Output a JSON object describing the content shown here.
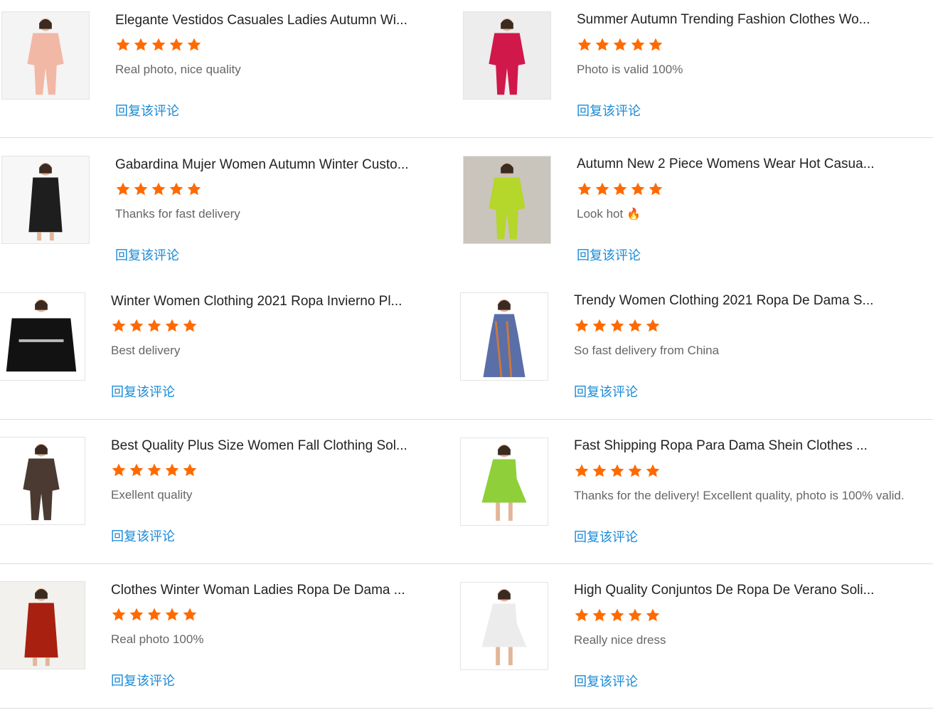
{
  "reviews": [
    {
      "title": "Elegante Vestidos Casuales Ladies Autumn Wi...",
      "comment": "Real photo, nice quality",
      "emoji": "",
      "reply": "回复该评论",
      "image": "pink-blazer-suit",
      "rating": 5
    },
    {
      "title": "Summer Autumn Trending Fashion Clothes Wo...",
      "comment": "Photo is valid 100%",
      "emoji": "",
      "reply": "回复该评论",
      "image": "magenta-suit",
      "rating": 5
    },
    {
      "title": "Gabardina Mujer Women Autumn Winter Custo...",
      "comment": "Thanks for fast delivery",
      "emoji": "",
      "reply": "回复该评论",
      "image": "black-long-coat",
      "rating": 5
    },
    {
      "title": "Autumn New 2 Piece Womens Wear Hot Casua...",
      "comment": "Look hot",
      "emoji": "🔥",
      "reply": "回复该评论",
      "image": "lime-green-suit",
      "rating": 5
    },
    {
      "title": "Winter Women Clothing 2021 Ropa Invierno Pl...",
      "comment": "Best delivery",
      "emoji": "",
      "reply": "回复该评论",
      "image": "black-blazer-chain",
      "rating": 5
    },
    {
      "title": "Trendy Women Clothing 2021 Ropa De Dama S...",
      "comment": "So fast delivery from China",
      "emoji": "",
      "reply": "回复该评论",
      "image": "printed-maxi-dress",
      "rating": 5
    },
    {
      "title": "Best Quality Plus Size Women Fall Clothing Sol...",
      "comment": "Exellent quality",
      "emoji": "",
      "reply": "回复该评论",
      "image": "brown-blazer-outfit",
      "rating": 5
    },
    {
      "title": "Fast Shipping Ropa Para Dama Shein Clothes ...",
      "comment": "Thanks for the delivery! Excellent quality, photo is 100% valid.",
      "emoji": "",
      "reply": "回复该评论",
      "image": "green-print-dress",
      "rating": 5
    },
    {
      "title": "Clothes Winter Woman Ladies Ropa De Dama ...",
      "comment": "Real photo 100%",
      "emoji": "",
      "reply": "回复该评论",
      "image": "red-trench-coat",
      "rating": 5
    },
    {
      "title": "High Quality Conjuntos De Ropa De Verano Soli...",
      "comment": "Really nice dress",
      "emoji": "",
      "reply": "回复该评论",
      "image": "white-lace-dress",
      "rating": 5
    }
  ],
  "colors": {
    "star": "#ff6a00",
    "reply_link": "#1a8ad6",
    "title": "#222222",
    "comment": "#666666",
    "divider": "#dcdcdc"
  },
  "icons": {
    "rating": "star-icon",
    "emoji": "fire-emoji-icon"
  }
}
